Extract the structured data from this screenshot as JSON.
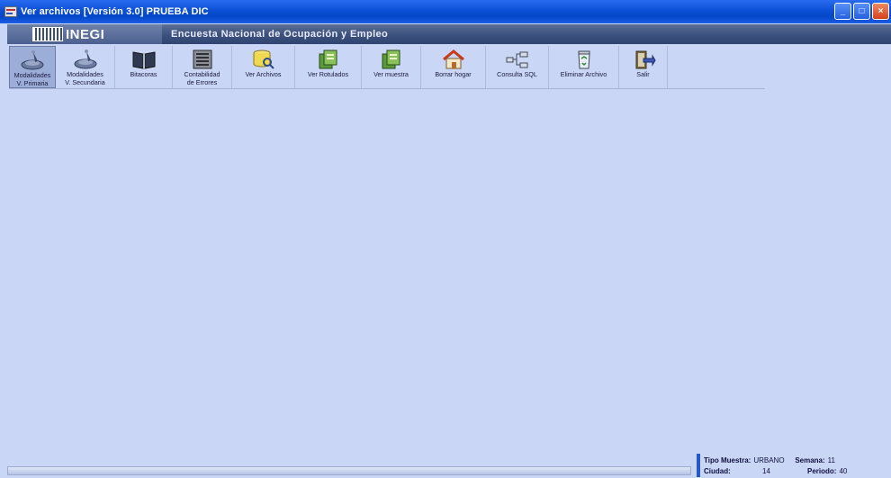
{
  "window": {
    "title": "Ver archivos [Versión 3.0] PRUEBA DIC",
    "buttons": {
      "minimize": "_",
      "maximize": "□",
      "close": "×"
    }
  },
  "banner": {
    "logo_text": "INEGI",
    "title": "Encuesta Nacional de Ocupación y Empleo"
  },
  "toolbar": {
    "items": [
      {
        "line1": "Modalidades",
        "line2": "V. Primaria",
        "icon": "dish-icon",
        "active": true
      },
      {
        "line1": "Modalidades",
        "line2": "V. Secundaria",
        "icon": "dish-icon",
        "active": false
      },
      {
        "line1": "Bitacoras",
        "line2": "",
        "icon": "book-icon",
        "active": false
      },
      {
        "line1": "Contabilidad",
        "line2": "de Errores",
        "icon": "ledger-icon",
        "active": false
      },
      {
        "line1": "Ver Archivos",
        "line2": "",
        "icon": "database-search-icon",
        "active": false
      },
      {
        "line1": "Ver Rotulados",
        "line2": "",
        "icon": "files-icon",
        "active": false
      },
      {
        "line1": "Ver muestra",
        "line2": "",
        "icon": "files-icon",
        "active": false
      },
      {
        "line1": "Borrar hogar",
        "line2": "",
        "icon": "house-icon",
        "active": false
      },
      {
        "line1": "Consulta SQL",
        "line2": "",
        "icon": "network-icon",
        "active": false
      },
      {
        "line1": "Eliminar Archivo",
        "line2": "",
        "icon": "recycle-bin-icon",
        "active": false
      },
      {
        "line1": "Salir",
        "line2": "",
        "icon": "exit-door-icon",
        "active": false
      }
    ]
  },
  "status": {
    "tipo_muestra_label": "Tipo Muestra:",
    "tipo_muestra_value": "URBANO",
    "semana_label": "Semana:",
    "semana_value": "11",
    "ciudad_label": "Ciudad:",
    "ciudad_value": "14",
    "periodo_label": "Periodo:",
    "periodo_value": "40"
  }
}
